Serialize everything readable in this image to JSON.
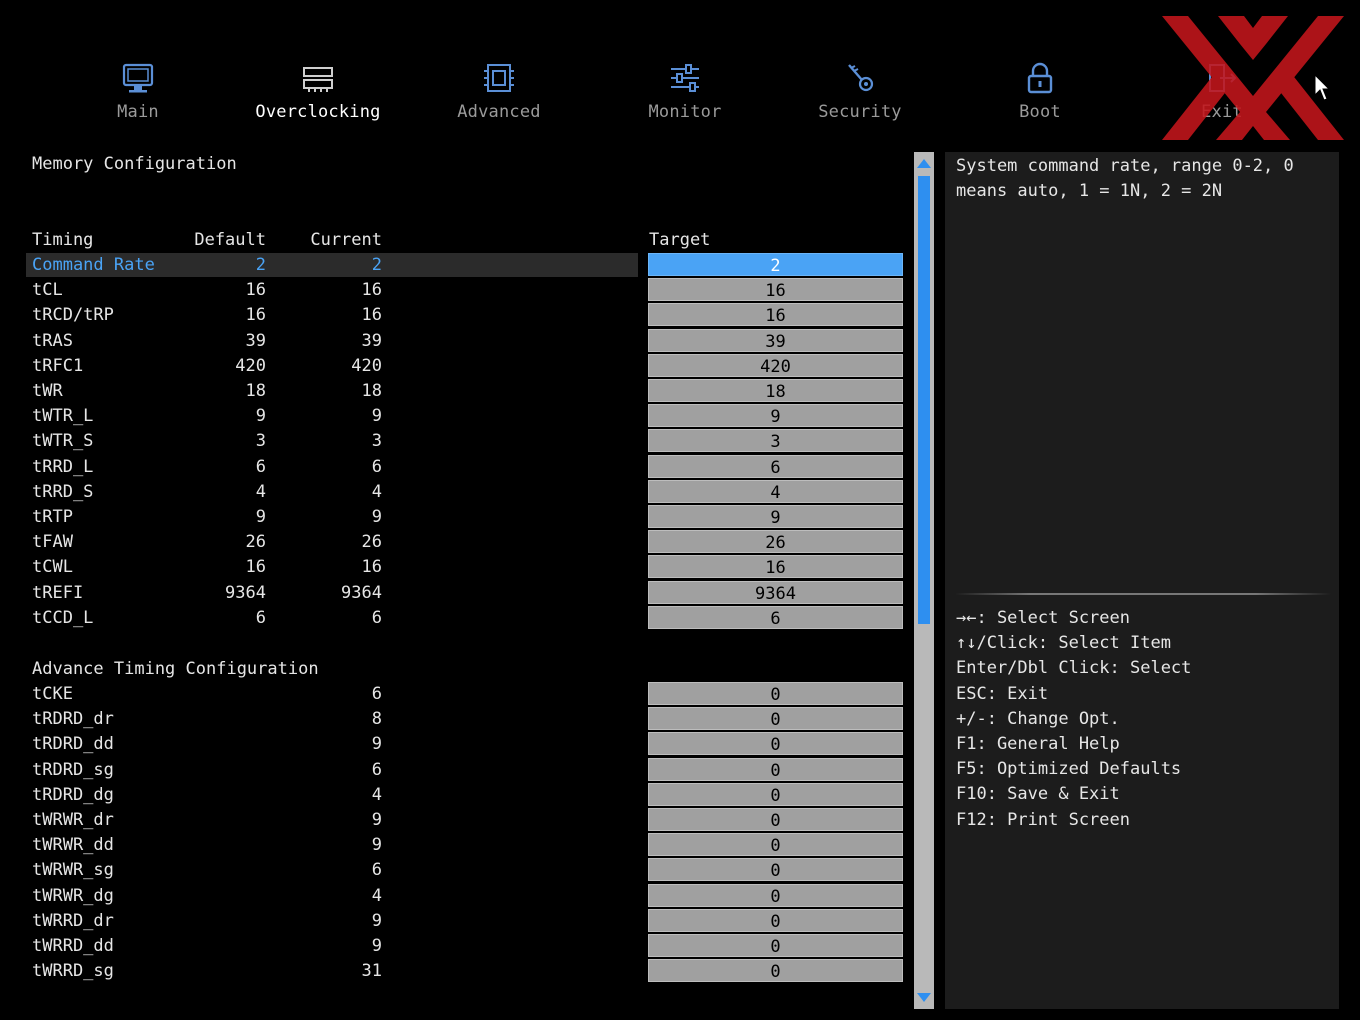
{
  "nav": {
    "items": [
      {
        "label": "Main",
        "icon": "monitor-icon",
        "active": false
      },
      {
        "label": "Overclocking",
        "icon": "memory-icon",
        "active": true
      },
      {
        "label": "Advanced",
        "icon": "chip-icon",
        "active": false
      },
      {
        "label": "Monitor",
        "icon": "sliders-icon",
        "active": false
      },
      {
        "label": "Security",
        "icon": "key-icon",
        "active": false
      },
      {
        "label": "Boot",
        "icon": "lock-icon",
        "active": false
      },
      {
        "label": "Exit",
        "icon": "exit-icon",
        "active": false
      }
    ]
  },
  "memory": {
    "title": "Memory Configuration",
    "headers": {
      "timing": "Timing",
      "default": "Default",
      "current": "Current",
      "target": "Target"
    },
    "rows": [
      {
        "name": "Command Rate",
        "default": "2",
        "current": "2",
        "target": "2",
        "selected": true
      },
      {
        "name": "tCL",
        "default": "16",
        "current": "16",
        "target": "16"
      },
      {
        "name": "tRCD/tRP",
        "default": "16",
        "current": "16",
        "target": "16"
      },
      {
        "name": "tRAS",
        "default": "39",
        "current": "39",
        "target": "39"
      },
      {
        "name": "tRFC1",
        "default": "420",
        "current": "420",
        "target": "420"
      },
      {
        "name": "tWR",
        "default": "18",
        "current": "18",
        "target": "18"
      },
      {
        "name": "tWTR_L",
        "default": "9",
        "current": "9",
        "target": "9"
      },
      {
        "name": "tWTR_S",
        "default": "3",
        "current": "3",
        "target": "3"
      },
      {
        "name": "tRRD_L",
        "default": "6",
        "current": "6",
        "target": "6"
      },
      {
        "name": "tRRD_S",
        "default": "4",
        "current": "4",
        "target": "4"
      },
      {
        "name": "tRTP",
        "default": "9",
        "current": "9",
        "target": "9"
      },
      {
        "name": "tFAW",
        "default": "26",
        "current": "26",
        "target": "26"
      },
      {
        "name": "tCWL",
        "default": "16",
        "current": "16",
        "target": "16"
      },
      {
        "name": "tREFI",
        "default": "9364",
        "current": "9364",
        "target": "9364"
      },
      {
        "name": "tCCD_L",
        "default": "6",
        "current": "6",
        "target": "6"
      }
    ]
  },
  "advance": {
    "title": "Advance Timing Configuration",
    "rows": [
      {
        "name": "tCKE",
        "current": "6",
        "target": "0"
      },
      {
        "name": "tRDRD_dr",
        "current": "8",
        "target": "0"
      },
      {
        "name": "tRDRD_dd",
        "current": "9",
        "target": "0"
      },
      {
        "name": "tRDRD_sg",
        "current": "6",
        "target": "0"
      },
      {
        "name": "tRDRD_dg",
        "current": "4",
        "target": "0"
      },
      {
        "name": "tWRWR_dr",
        "current": "9",
        "target": "0"
      },
      {
        "name": "tWRWR_dd",
        "current": "9",
        "target": "0"
      },
      {
        "name": "tWRWR_sg",
        "current": "6",
        "target": "0"
      },
      {
        "name": "tWRWR_dg",
        "current": "4",
        "target": "0"
      },
      {
        "name": "tWRRD_dr",
        "current": "9",
        "target": "0"
      },
      {
        "name": "tWRRD_dd",
        "current": "9",
        "target": "0"
      },
      {
        "name": "tWRRD_sg",
        "current": "31",
        "target": "0"
      }
    ]
  },
  "help": {
    "description": "System command rate, range 0-2, 0\nmeans auto, 1 = 1N, 2 = 2N",
    "keys": [
      "→←: Select Screen",
      "↑↓/Click: Select Item",
      "Enter/Dbl Click: Select",
      "ESC: Exit",
      "+/-: Change Opt.",
      "F1: General Help",
      "F5: Optimized Defaults",
      "F10: Save & Exit",
      "F12: Print Screen"
    ]
  },
  "colors": {
    "accent": "#4aa3f5",
    "icon": "#5b8fd6",
    "target_bg": "#a0a0a0",
    "panel_bg": "#1c1c1c",
    "logo": "#c4161c"
  }
}
